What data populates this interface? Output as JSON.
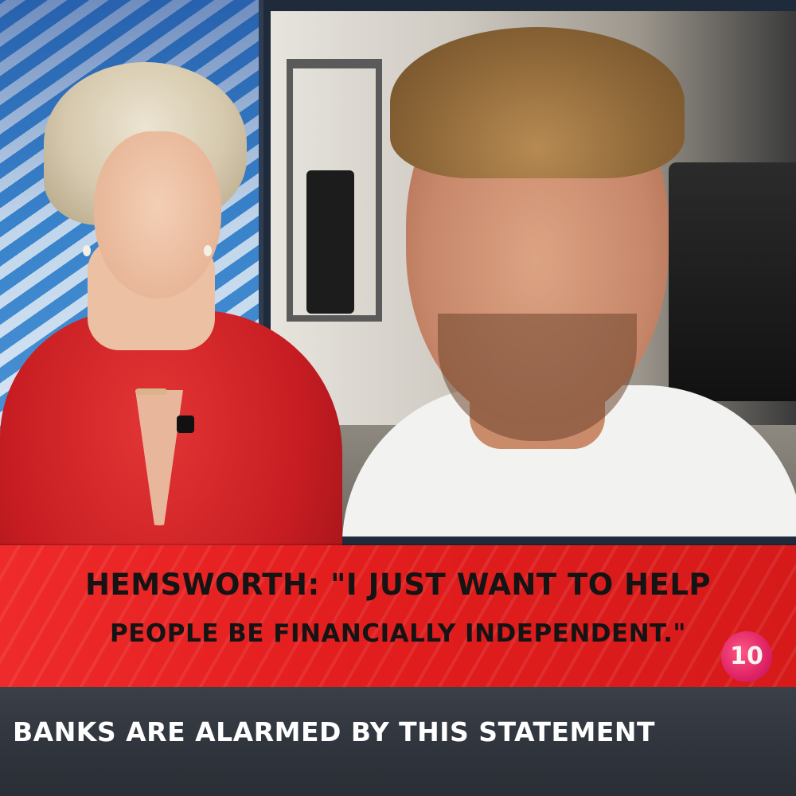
{
  "headline": {
    "line1": "HEMSWORTH: \"I JUST WANT TO HELP",
    "line2": "PEOPLE BE FINANCIALLY INDEPENDENT.\""
  },
  "caption": {
    "text": "BANKS ARE ALARMED BY THIS STATEMENT"
  },
  "logo": {
    "text": "10"
  },
  "colors": {
    "headline_band": "#e21d1d",
    "caption_bar": "#2f343c",
    "headline_text": "#141414",
    "caption_text": "#ffffff",
    "logo": "#e0246a"
  }
}
